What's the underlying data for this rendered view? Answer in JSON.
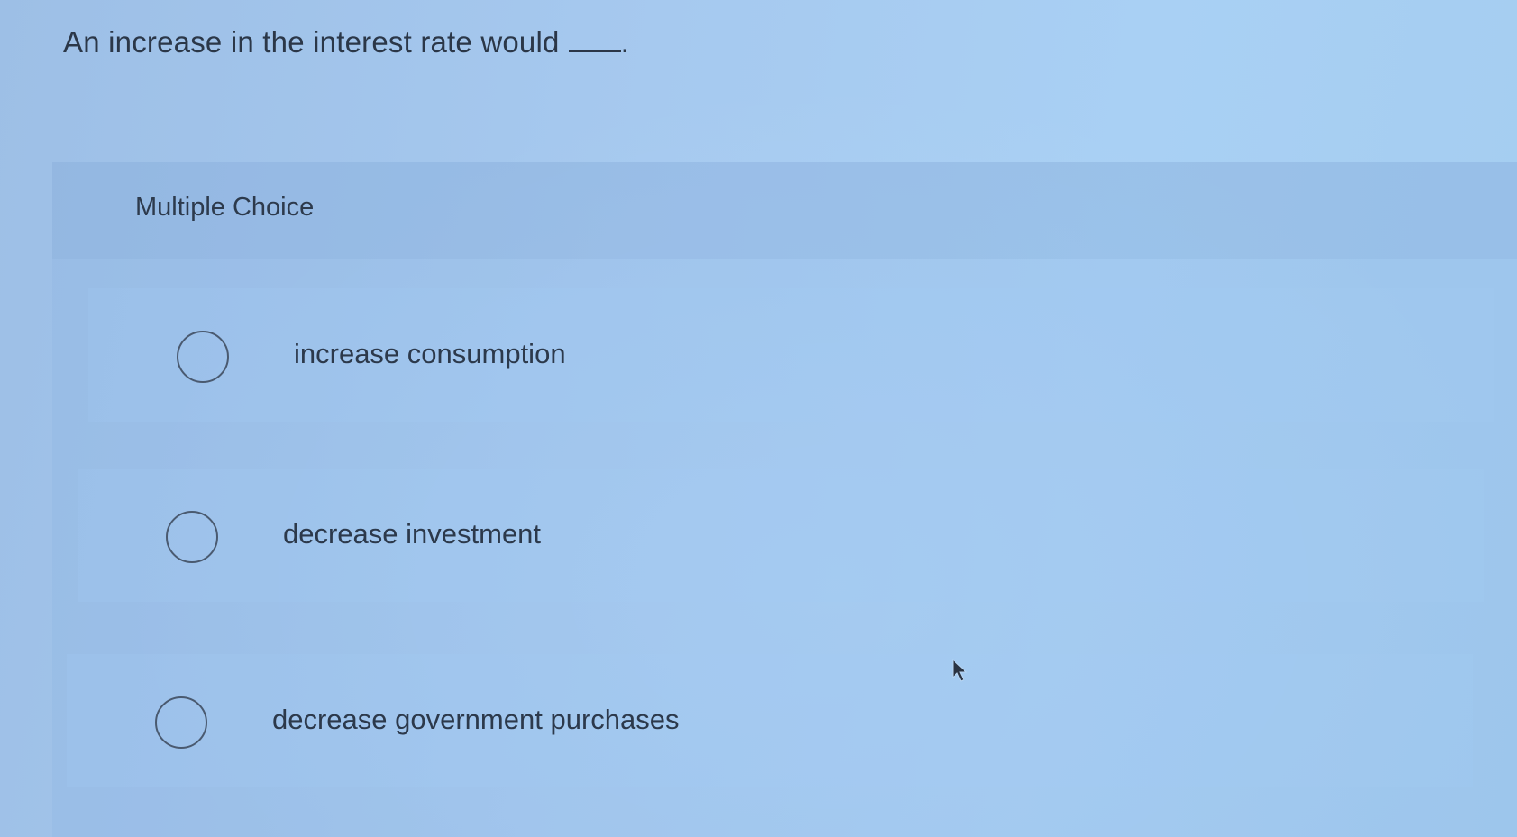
{
  "question": {
    "text": "An increase in the interest rate would",
    "trailing_punctuation": "."
  },
  "panel": {
    "label": "Multiple Choice"
  },
  "options": [
    {
      "label": "increase consumption",
      "selected": false
    },
    {
      "label": "decrease investment",
      "selected": false
    },
    {
      "label": "decrease government purchases",
      "selected": false
    }
  ],
  "colors": {
    "background": "#a6c9ef",
    "text": "#2b3748",
    "radio_border": "#4a5a70"
  }
}
